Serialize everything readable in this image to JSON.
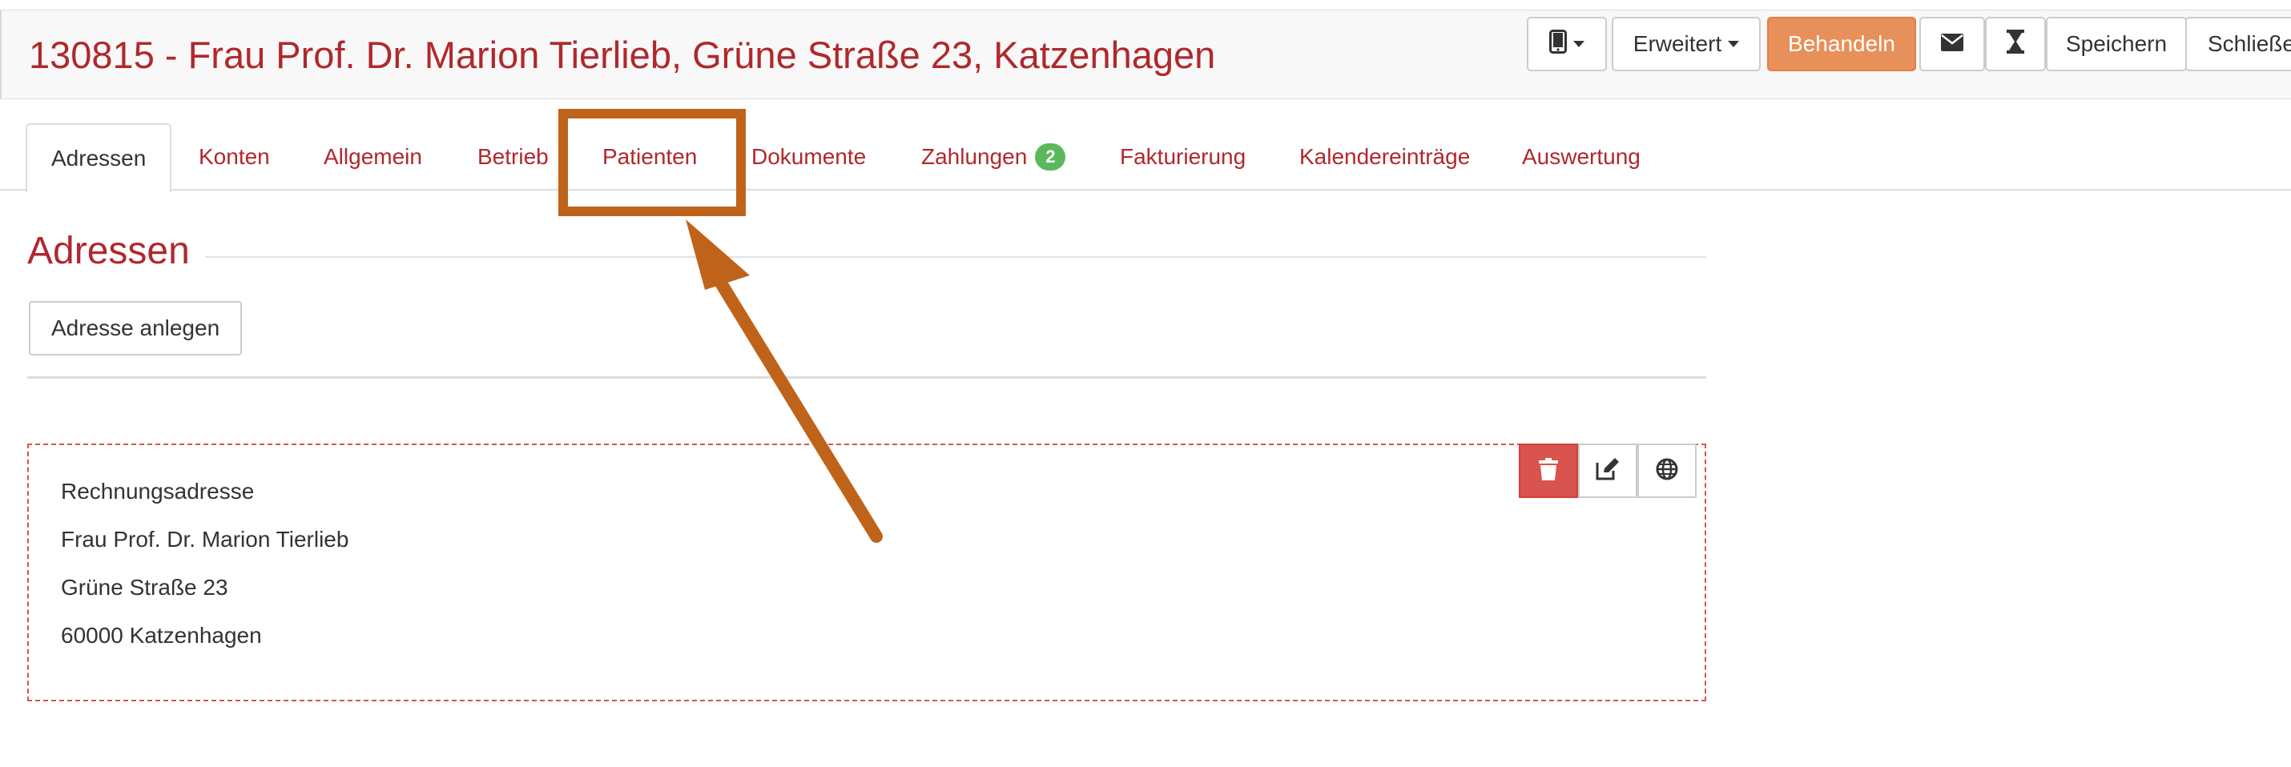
{
  "header": {
    "title": "130815 - Frau Prof. Dr. Marion Tierlieb, Grüne Straße 23, Katzenhagen",
    "buttons": {
      "device_icon": "tablet-icon",
      "erweitert": "Erweitert",
      "behandeln": "Behandeln",
      "mail_icon": "envelope-icon",
      "timer_icon": "hourglass-icon",
      "speichern": "Speichern",
      "schliessen": "Schließe"
    }
  },
  "tabs": [
    {
      "label": "Adressen",
      "active": true
    },
    {
      "label": "Konten"
    },
    {
      "label": "Allgemein"
    },
    {
      "label": "Betrieb"
    },
    {
      "label": "Patienten",
      "highlighted": true
    },
    {
      "label": "Dokumente"
    },
    {
      "label": "Zahlungen",
      "badge": "2"
    },
    {
      "label": "Fakturierung"
    },
    {
      "label": "Kalendereinträge"
    },
    {
      "label": "Auswertung"
    }
  ],
  "section": {
    "title": "Adressen",
    "add_button": "Adresse anlegen"
  },
  "address_card": {
    "type": "Rechnungsadresse",
    "name": "Frau Prof. Dr. Marion Tierlieb",
    "street": "Grüne Straße 23",
    "city": "60000 Katzenhagen",
    "actions": [
      "trash-icon",
      "edit-icon",
      "globe-icon"
    ]
  },
  "colors": {
    "accent_red": "#b0282c",
    "primary_orange": "#e8905a",
    "badge_green": "#5cb85c",
    "danger": "#d9534f",
    "annotation": "#c0631a"
  }
}
